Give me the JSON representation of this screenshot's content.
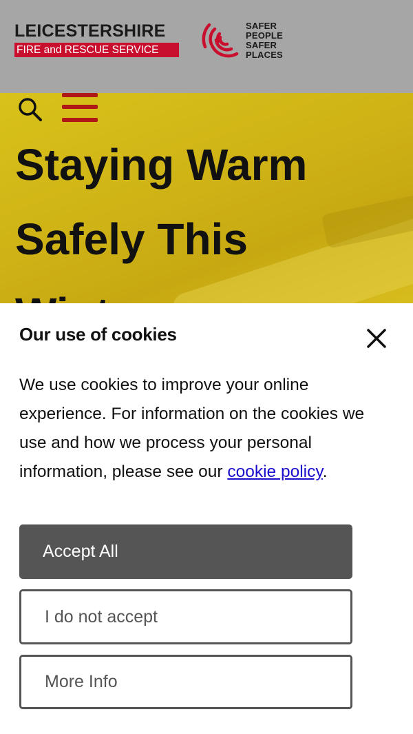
{
  "header": {
    "logo_title": "LEICESTERSHIRE",
    "logo_subtitle": "FIRE and RESCUE SERVICE",
    "slogan": [
      "SAFER",
      "PEOPLE",
      "SAFER",
      "PLACES"
    ],
    "brand_red": "#c8102e",
    "background": "#a6a6a6"
  },
  "nav": {
    "search_icon": "search-icon",
    "menu_icon": "hamburger-menu-icon",
    "menu_color": "#b01717"
  },
  "hero": {
    "title_lines": [
      "Staying Warm",
      "Safely This",
      "Winter"
    ],
    "background": "#cfb316"
  },
  "cookie_banner": {
    "title": "Our use of cookies",
    "close_icon": "close-icon",
    "text_before_link": "We use cookies to improve your online experience. For information on the cookies we use and how we process your personal information, please see our ",
    "link_text": "cookie policy",
    "text_after_link": ".",
    "buttons": {
      "accept_all": "Accept All",
      "reject": "I do not accept",
      "more_info": "More Info"
    },
    "button_color": "#555555",
    "link_color": "#1a0dcc"
  }
}
